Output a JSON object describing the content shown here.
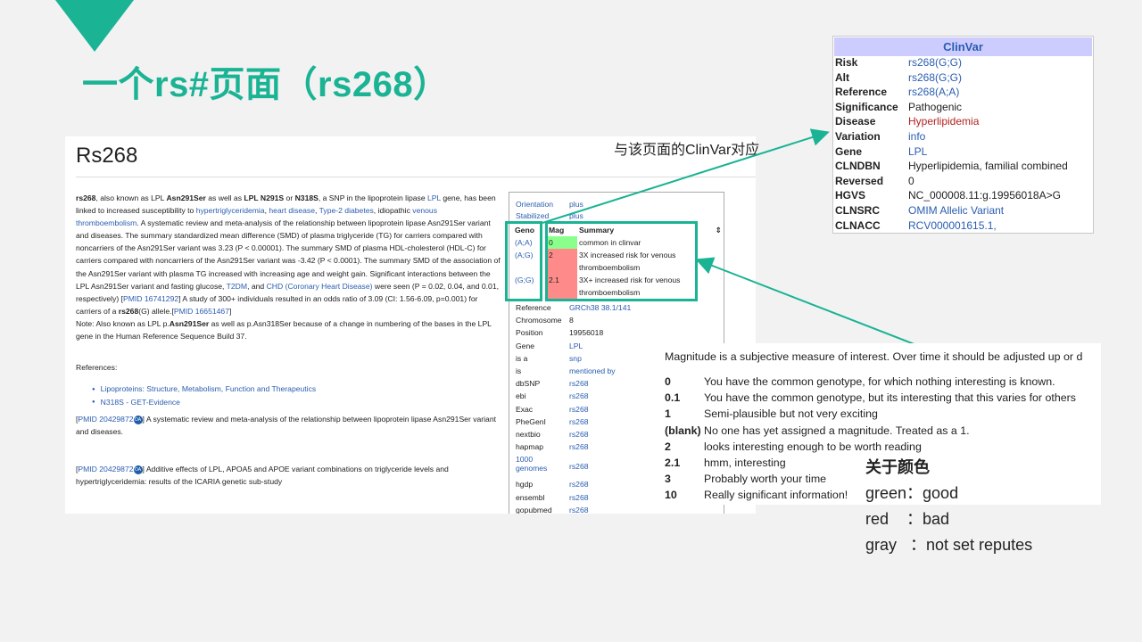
{
  "slide_title": "一个rs#页面（rs268）",
  "snp_page": {
    "title": "Rs268",
    "description_html": "<b>rs268</b>, also known as LPL <b>Asn291Ser</b> as well as <b>LPL N291S</b> or <b>N318S</b>, a SNP in the lipoprotein lipase <a>LPL</a> gene, has been linked to increased susceptibility to <a>hypertriglyceridemia</a>, <a>heart disease</a>, <a>Type-2 diabetes</a>, idiopathic <a>venous thromboembolism</a>. A systematic review and meta-analysis of the relationship between lipoprotein lipase Asn291Ser variant and diseases. The summary standardized mean difference (SMD) of plasma triglyceride (TG) for carriers compared with noncarriers of the Asn291Ser variant was 3.23 (P &lt; 0.00001). The summary SMD of plasma HDL-cholesterol (HDL-C) for carriers compared with noncarriers of the Asn291Ser variant was -3.42 (P &lt; 0.0001). The summary SMD of the association of the Asn291Ser variant with plasma TG increased with increasing age and weight gain. Significant interactions between the LPL Asn291Ser variant and fasting glucose, <a>T2DM</a>, and <a>CHD (Coronary Heart Disease)</a> were seen (P = 0.02, 0.04, and 0.01, respectively) [<a>PMID 16741292</a>] A study of 300+ individuals resulted in an odds ratio of 3.09 (CI: 1.56-6.09, p=0.001) for carriers of a <b>rs268</b>(G) allele.[<a>PMID 16651467</a>]<br>Note: Also known as LPL p.<b>Asn291Ser</b> as well as p.Asn318Ser because of a change in numbering of the bases in the LPL gene in the Human Reference Sequence Build 37.",
    "references_heading": "References:",
    "references": [
      "Lipoproteins: Structure, Metabolism, Function and Therapeutics",
      "N318S - GET-Evidence"
    ],
    "pmids": [
      {
        "link": "PMID 20429872",
        "oa": "OA",
        "text": "A systematic review and meta-analysis of the relationship between lipoprotein lipase Asn291Ser variant and diseases."
      },
      {
        "link": "PMID 20429872",
        "oa": "OA",
        "text": "Additive effects of LPL, APOA5 and APOE variant combinations on triglyceride levels and hypertriglyceridemia: results of the ICARIA genetic sub-study"
      }
    ],
    "infobox": {
      "orientation": {
        "label": "Orientation",
        "value": "plus"
      },
      "stabilized": {
        "label": "Stabilized",
        "value": "plus"
      },
      "genotype_headers": [
        "Geno",
        "Mag",
        "Summary"
      ],
      "sort_icon": "⇕",
      "genotypes": [
        {
          "geno": "(A;A)",
          "mag": "0",
          "summary": "common in clinvar",
          "color": "#8bff8b"
        },
        {
          "geno": "(A;G)",
          "mag": "2",
          "summary": "3X increased risk for venous thromboembolism",
          "color": "#ff8a8a"
        },
        {
          "geno": "(G;G)",
          "mag": "2.1",
          "summary": "3X+ increased risk for venous thromboembolism",
          "color": "#ff8a8a"
        }
      ],
      "fields": [
        {
          "label": "Reference",
          "value": "GRCh38 38.1/141",
          "link": true
        },
        {
          "label": "Chromosome",
          "value": "8",
          "link": false
        },
        {
          "label": "Position",
          "value": "19956018",
          "link": false
        },
        {
          "label": "Gene",
          "value": "LPL",
          "link": true
        },
        {
          "label": "is a",
          "value": "snp",
          "link": true
        },
        {
          "label": "is",
          "value": "mentioned by",
          "link": true
        },
        {
          "label": "dbSNP",
          "value": "rs268",
          "link": true
        },
        {
          "label": "ebi",
          "value": "rs268",
          "link": true
        },
        {
          "label": "Exac",
          "value": "rs268",
          "link": true
        },
        {
          "label": "PheGenI",
          "value": "rs268",
          "link": true
        },
        {
          "label": "nextbio",
          "value": "rs268",
          "link": true
        },
        {
          "label": "hapmap",
          "value": "rs268",
          "link": true
        },
        {
          "label": "1000 genomes",
          "value": "rs268",
          "link": true
        },
        {
          "label": "hgdp",
          "value": "rs268",
          "link": true
        },
        {
          "label": "ensembl",
          "value": "rs268",
          "link": true
        },
        {
          "label": "gopubmed",
          "value": "rs268",
          "link": true
        }
      ]
    }
  },
  "clinvar": {
    "title": "ClinVar",
    "rows": [
      {
        "label": "Risk",
        "value": "rs268(G;G)",
        "style": "link"
      },
      {
        "label": "Alt",
        "value": "rs268(G;G)",
        "style": "link"
      },
      {
        "label": "Reference",
        "value": "rs268(A;A)",
        "style": "link"
      },
      {
        "label": "Significance",
        "value": "Pathogenic",
        "style": "plain"
      },
      {
        "label": "Disease",
        "value": "Hyperlipidemia",
        "style": "red"
      },
      {
        "label": "Variation",
        "value": "info",
        "style": "link"
      },
      {
        "label": "Gene",
        "value": "LPL",
        "style": "link"
      },
      {
        "label": "CLNDBN",
        "value": "Hyperlipidemia, familial combined",
        "style": "plain"
      },
      {
        "label": "Reversed",
        "value": "0",
        "style": "plain"
      },
      {
        "label": "HGVS",
        "value": "NC_000008.11:g.19956018A>G",
        "style": "plain"
      },
      {
        "label": "CLNSRC",
        "value": "OMIM Allelic Variant",
        "style": "link"
      },
      {
        "label": "CLNACC",
        "value": "RCV000001615.1,",
        "style": "link"
      }
    ]
  },
  "annotation": "与该页面的ClinVar对应",
  "magnitude": {
    "intro": "Magnitude is a subjective measure of interest. Over time it should be adjusted up or d",
    "rows": [
      {
        "mag": "0",
        "text": "You have the common genotype, for which nothing interesting is known."
      },
      {
        "mag": "0.1",
        "text": "You have the common genotype, but its interesting that this varies for others"
      },
      {
        "mag": "1",
        "text": "Semi-plausible but not very exciting"
      },
      {
        "mag": "(blank)",
        "text": "No one has yet assigned a magnitude. Treated as a 1."
      },
      {
        "mag": "2",
        "text": "looks interesting enough to be worth reading"
      },
      {
        "mag": "2.1",
        "text": "hmm, interesting"
      },
      {
        "mag": "3",
        "text": "Probably worth your time"
      },
      {
        "mag": "10",
        "text": "Really significant information!"
      }
    ]
  },
  "color_legend": {
    "heading": "关于颜色",
    "items": [
      "green：good",
      "red    ：bad",
      "gray   ：not set reputes"
    ]
  },
  "colors": {
    "accent": "#1ab394",
    "link": "#2a5db0",
    "clinvar_header": "#ccccff"
  }
}
